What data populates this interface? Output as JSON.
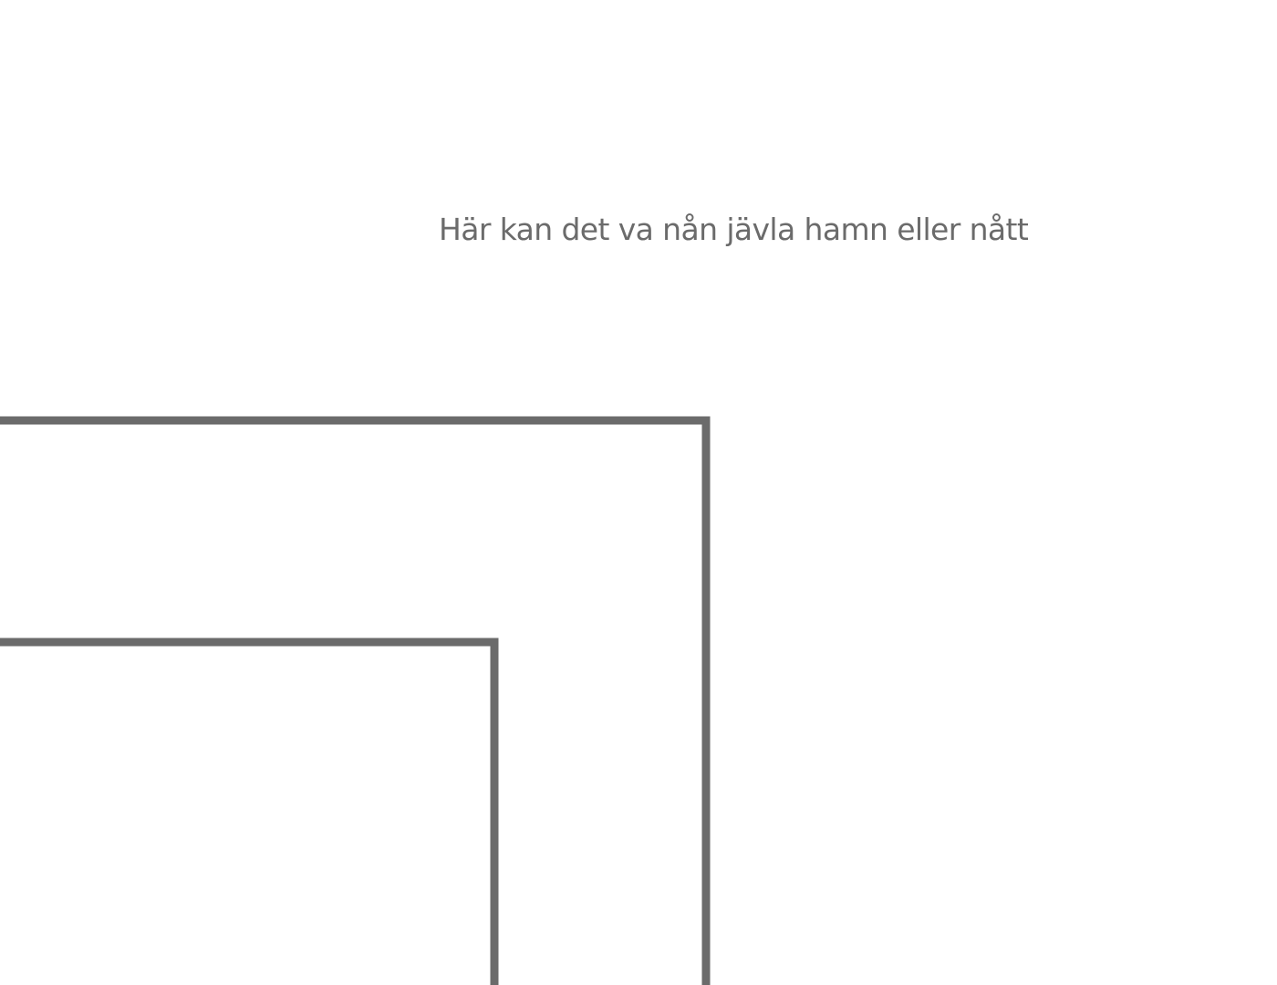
{
  "annotation": {
    "text": "Här kan det va nån jävla hamn eller nått"
  },
  "colors": {
    "background": "#ffffff",
    "line": "#6b6b6b",
    "text": "#6b6b6b"
  }
}
